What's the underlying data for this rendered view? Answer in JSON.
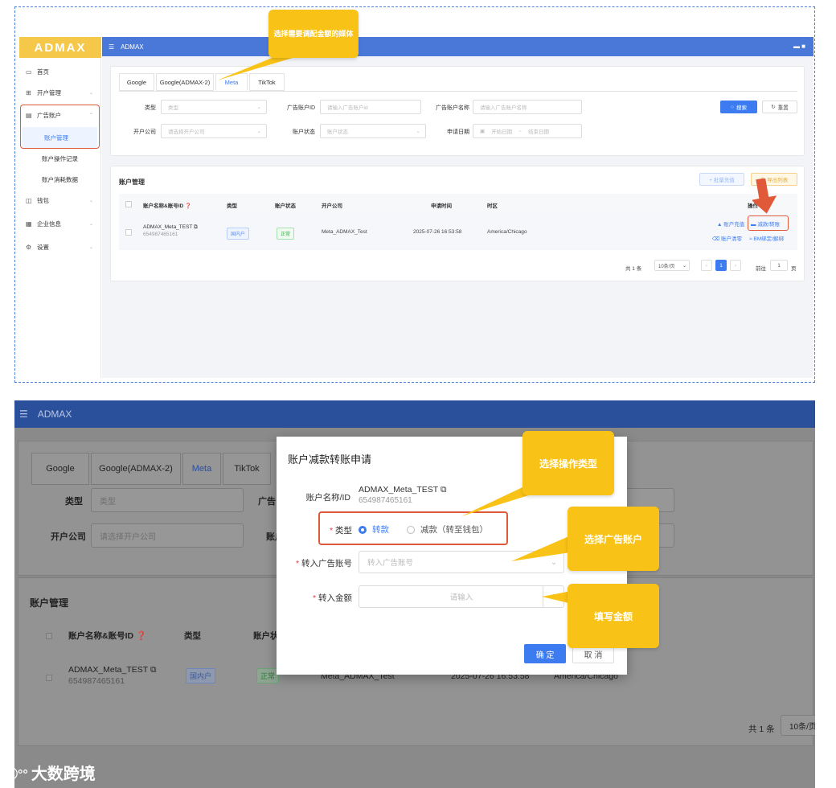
{
  "top": {
    "logo": "ADMAX",
    "header_title": "ADMAX",
    "sidebar": {
      "home": "首页",
      "open_mgmt": "开户管理",
      "ad_account": "广告账户",
      "account_mgmt": "账户管理",
      "account_op_log": "账户操作记录",
      "account_spend": "账户消耗数据",
      "wallet": "钱包",
      "company_info": "企业信息",
      "settings": "设置"
    },
    "tabs": [
      "Google",
      "Google(ADMAX-2)",
      "Meta",
      "TikTok"
    ],
    "filters": {
      "type_label": "类型",
      "type_placeholder": "类型",
      "ad_id_label": "广告账户ID",
      "ad_id_placeholder": "请输入广告账户id",
      "ad_name_label": "广告账户名称",
      "ad_name_placeholder": "请输入广告账户名称",
      "company_label": "开户公司",
      "company_placeholder": "请选择开户公司",
      "status_label": "账户状态",
      "status_placeholder": "账户状态",
      "date_label": "申请日期",
      "date_start": "开始日期",
      "date_sep": "~",
      "date_end": "结束日期",
      "search_btn": "搜索",
      "reset_btn": "重置"
    },
    "list": {
      "title": "账户管理",
      "batch_btn": "+ 批量充值",
      "export_btn": "导出列表",
      "columns": [
        "账户名称&账号ID",
        "类型",
        "账户状态",
        "开户公司",
        "申请时间",
        "时区",
        "操作"
      ],
      "row": {
        "name": "ADMAX_Meta_TEST",
        "id": "654987465161",
        "type": "国内户",
        "status": "正常",
        "company": "Meta_ADMAX_Test",
        "time": "2025-07-26 16:53:58",
        "tz": "America/Chicago",
        "op_recharge": "账户充值",
        "op_reduce": "减款/转账",
        "op_clear": "账户清零",
        "op_bm": "BM绑定/解绑"
      },
      "pagination": {
        "total": "共 1 条",
        "per_page": "10条/页",
        "page": "1",
        "goto": "前往",
        "goto_page": "1",
        "page_suffix": "页"
      }
    },
    "callout": "选择需要调配金额的媒体"
  },
  "bottom": {
    "header_title": "ADMAX",
    "tabs": [
      "Google",
      "Google(ADMAX-2)",
      "Meta",
      "TikTok"
    ],
    "type_label": "类型",
    "type_placeholder": "类型",
    "company_label": "开户公司",
    "company_placeholder": "请选择开户公司",
    "ad_label_partial": "广告",
    "acct_label_partial": "账户",
    "list_title": "账户管理",
    "col_name": "账户名称&账号ID",
    "col_type": "类型",
    "col_status": "账户状",
    "row_name": "ADMAX_Meta_TEST",
    "row_id": "654987465161",
    "row_type": "国内户",
    "row_status": "正常",
    "row_company": "Meta_ADMAX_Test",
    "row_time": "2025-07-26 16:53:58",
    "row_tz": "America/Chicago",
    "total": "共 1 条",
    "per_page": "10条/页",
    "modal": {
      "title": "账户减款转账申请",
      "name_label": "账户名称/ID",
      "name": "ADMAX_Meta_TEST",
      "id": "654987465161",
      "type_label": "类型",
      "opt_transfer": "转款",
      "opt_reduce": "减款（转至钱包）",
      "target_label": "转入广告账号",
      "target_placeholder": "转入广告账号",
      "amount_label": "转入金额",
      "amount_placeholder": "请输入",
      "currency": "US",
      "confirm": "确 定",
      "cancel": "取 消"
    },
    "callouts": [
      "选择操作类型",
      "选择广告账户",
      "填写金额"
    ]
  },
  "watermark": "大数跨境",
  "colors": {
    "primary": "#3c7bf0",
    "header": "#4a78d9",
    "callout": "#f9c217",
    "highlight_red": "#e05a3a",
    "logo": "#f5c84a"
  }
}
